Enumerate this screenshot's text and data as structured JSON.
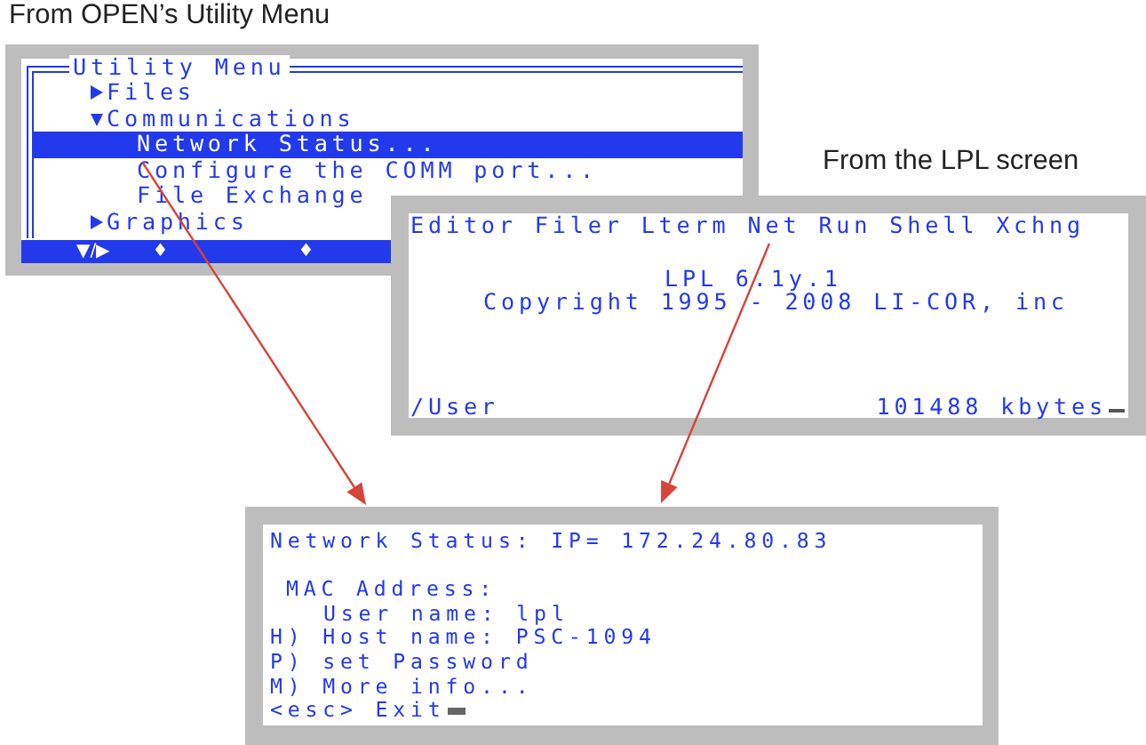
{
  "utility_menu_caption": "From OPEN’s Utility Menu",
  "utility_menu": {
    "title": "Utility Menu",
    "items": [
      {
        "label": "Files",
        "expanded": false,
        "selected": false
      },
      {
        "label": "Communications",
        "expanded": true,
        "selected": false,
        "children": [
          {
            "label": "Network Status...",
            "selected": true
          },
          {
            "label": "Configure the COMM port...",
            "selected": false
          },
          {
            "label": "File Exchange",
            "selected": false
          }
        ]
      },
      {
        "label": "Graphics",
        "expanded": false,
        "selected": false
      }
    ],
    "footer_keys": [
      "▼/▶",
      "♦",
      "♦"
    ]
  },
  "lpl_caption": "From the LPL screen",
  "lpl_screen": {
    "menu": [
      "Editor",
      "Filer",
      "Lterm",
      "Net",
      "Run",
      "Shell",
      "Xchng"
    ],
    "version": "LPL 6.1y.1",
    "copyright": "Copyright 1995 - 2008 LI-COR, inc",
    "path": "/User",
    "memory": "101488 kbytes"
  },
  "network_status": {
    "lines": [
      {
        "kind": "heading",
        "text": "Network Status: IP= 172.24.80.83"
      },
      {
        "kind": "label",
        "text": "MAC Address:"
      },
      {
        "kind": "field",
        "text": "User name: lpl"
      },
      {
        "kind": "option",
        "text": "H) Host name: PSC-1094"
      },
      {
        "kind": "option",
        "text": "P) set Password"
      },
      {
        "kind": "option",
        "text": "M) More info..."
      },
      {
        "kind": "option",
        "text": "<esc> Exit"
      }
    ]
  }
}
